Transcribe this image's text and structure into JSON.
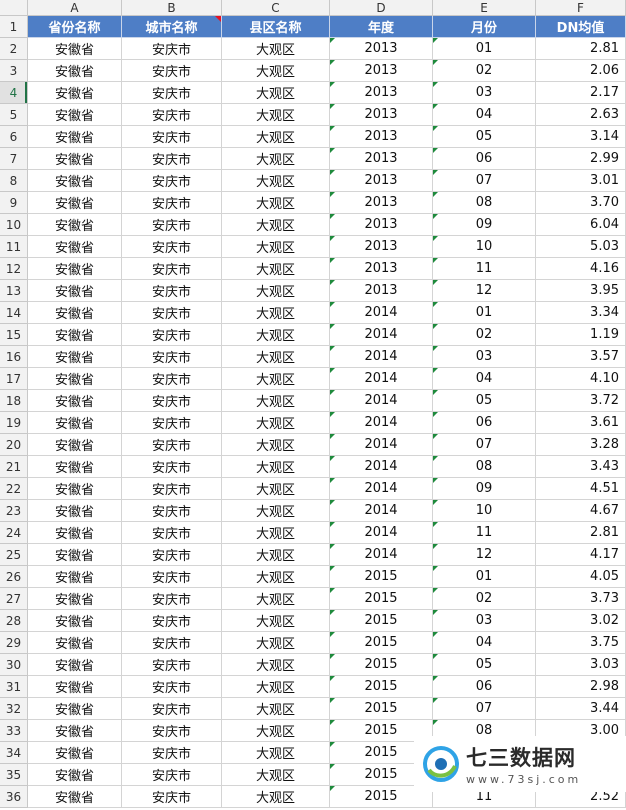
{
  "columns": [
    "A",
    "B",
    "C",
    "D",
    "E",
    "F"
  ],
  "header": [
    "省份名称",
    "城市名称",
    "县区名称",
    "年度",
    "月份",
    "DN均值"
  ],
  "rows": [
    [
      "2",
      "安徽省",
      "安庆市",
      "大观区",
      "2013",
      "01",
      "2.81"
    ],
    [
      "3",
      "安徽省",
      "安庆市",
      "大观区",
      "2013",
      "02",
      "2.06"
    ],
    [
      "4",
      "安徽省",
      "安庆市",
      "大观区",
      "2013",
      "03",
      "2.17"
    ],
    [
      "5",
      "安徽省",
      "安庆市",
      "大观区",
      "2013",
      "04",
      "2.63"
    ],
    [
      "6",
      "安徽省",
      "安庆市",
      "大观区",
      "2013",
      "05",
      "3.14"
    ],
    [
      "7",
      "安徽省",
      "安庆市",
      "大观区",
      "2013",
      "06",
      "2.99"
    ],
    [
      "8",
      "安徽省",
      "安庆市",
      "大观区",
      "2013",
      "07",
      "3.01"
    ],
    [
      "9",
      "安徽省",
      "安庆市",
      "大观区",
      "2013",
      "08",
      "3.70"
    ],
    [
      "10",
      "安徽省",
      "安庆市",
      "大观区",
      "2013",
      "09",
      "6.04"
    ],
    [
      "11",
      "安徽省",
      "安庆市",
      "大观区",
      "2013",
      "10",
      "5.03"
    ],
    [
      "12",
      "安徽省",
      "安庆市",
      "大观区",
      "2013",
      "11",
      "4.16"
    ],
    [
      "13",
      "安徽省",
      "安庆市",
      "大观区",
      "2013",
      "12",
      "3.95"
    ],
    [
      "14",
      "安徽省",
      "安庆市",
      "大观区",
      "2014",
      "01",
      "3.34"
    ],
    [
      "15",
      "安徽省",
      "安庆市",
      "大观区",
      "2014",
      "02",
      "1.19"
    ],
    [
      "16",
      "安徽省",
      "安庆市",
      "大观区",
      "2014",
      "03",
      "3.57"
    ],
    [
      "17",
      "安徽省",
      "安庆市",
      "大观区",
      "2014",
      "04",
      "4.10"
    ],
    [
      "18",
      "安徽省",
      "安庆市",
      "大观区",
      "2014",
      "05",
      "3.72"
    ],
    [
      "19",
      "安徽省",
      "安庆市",
      "大观区",
      "2014",
      "06",
      "3.61"
    ],
    [
      "20",
      "安徽省",
      "安庆市",
      "大观区",
      "2014",
      "07",
      "3.28"
    ],
    [
      "21",
      "安徽省",
      "安庆市",
      "大观区",
      "2014",
      "08",
      "3.43"
    ],
    [
      "22",
      "安徽省",
      "安庆市",
      "大观区",
      "2014",
      "09",
      "4.51"
    ],
    [
      "23",
      "安徽省",
      "安庆市",
      "大观区",
      "2014",
      "10",
      "4.67"
    ],
    [
      "24",
      "安徽省",
      "安庆市",
      "大观区",
      "2014",
      "11",
      "2.81"
    ],
    [
      "25",
      "安徽省",
      "安庆市",
      "大观区",
      "2014",
      "12",
      "4.17"
    ],
    [
      "26",
      "安徽省",
      "安庆市",
      "大观区",
      "2015",
      "01",
      "4.05"
    ],
    [
      "27",
      "安徽省",
      "安庆市",
      "大观区",
      "2015",
      "02",
      "3.73"
    ],
    [
      "28",
      "安徽省",
      "安庆市",
      "大观区",
      "2015",
      "03",
      "3.02"
    ],
    [
      "29",
      "安徽省",
      "安庆市",
      "大观区",
      "2015",
      "04",
      "3.75"
    ],
    [
      "30",
      "安徽省",
      "安庆市",
      "大观区",
      "2015",
      "05",
      "3.03"
    ],
    [
      "31",
      "安徽省",
      "安庆市",
      "大观区",
      "2015",
      "06",
      "2.98"
    ],
    [
      "32",
      "安徽省",
      "安庆市",
      "大观区",
      "2015",
      "07",
      "3.44"
    ],
    [
      "33",
      "安徽省",
      "安庆市",
      "大观区",
      "2015",
      "08",
      "3.00"
    ],
    [
      "34",
      "安徽省",
      "安庆市",
      "大观区",
      "2015",
      "",
      ""
    ],
    [
      "35",
      "安徽省",
      "安庆市",
      "大观区",
      "2015",
      "",
      ""
    ],
    [
      "36",
      "安徽省",
      "安庆市",
      "大观区",
      "2015",
      "11",
      "2.52"
    ]
  ],
  "watermark": {
    "title": "七三数据网",
    "url": "www.73sj.com"
  },
  "colors": {
    "header_fill": "#4e7ec6",
    "text_indicator": "#1e8a3c",
    "comment_indicator": "#e81123",
    "active_row": "#217346"
  }
}
